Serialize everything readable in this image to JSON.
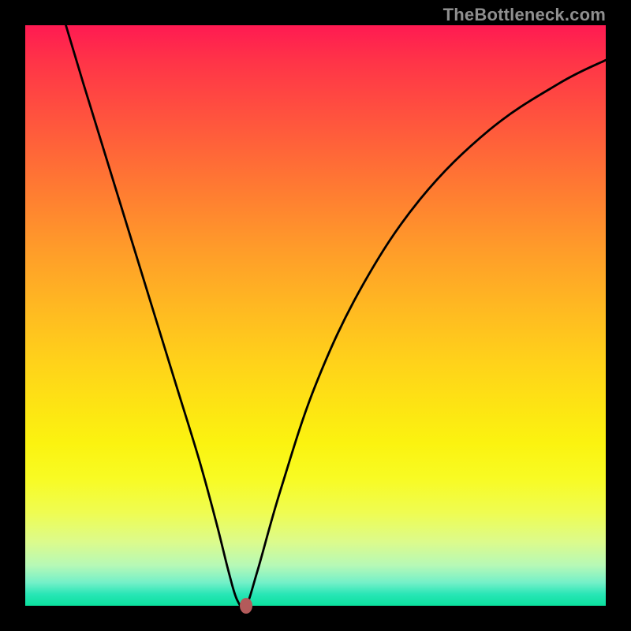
{
  "watermark": "TheBottleneck.com",
  "colors": {
    "frame": "#000000",
    "curve": "#000000",
    "marker": "#b35a5a"
  },
  "chart_data": {
    "type": "line",
    "title": "",
    "xlabel": "",
    "ylabel": "",
    "xlim": [
      0,
      100
    ],
    "ylim": [
      0,
      100
    ],
    "grid": false,
    "series": [
      {
        "name": "bottleneck-curve",
        "x": [
          7,
          10,
          14,
          18,
          22,
          26,
          30,
          33,
          35,
          36.5,
          38,
          40,
          44,
          50,
          58,
          68,
          80,
          92,
          100
        ],
        "values": [
          100,
          90,
          77,
          64,
          51,
          38,
          25,
          14,
          6,
          1,
          0,
          6,
          20,
          38,
          55,
          70,
          82,
          90,
          94
        ]
      }
    ],
    "marker": {
      "x": 38,
      "y": 0
    },
    "background_gradient": {
      "top": "#ff1a52",
      "mid": "#fde513",
      "bottom": "#0be09e"
    }
  }
}
